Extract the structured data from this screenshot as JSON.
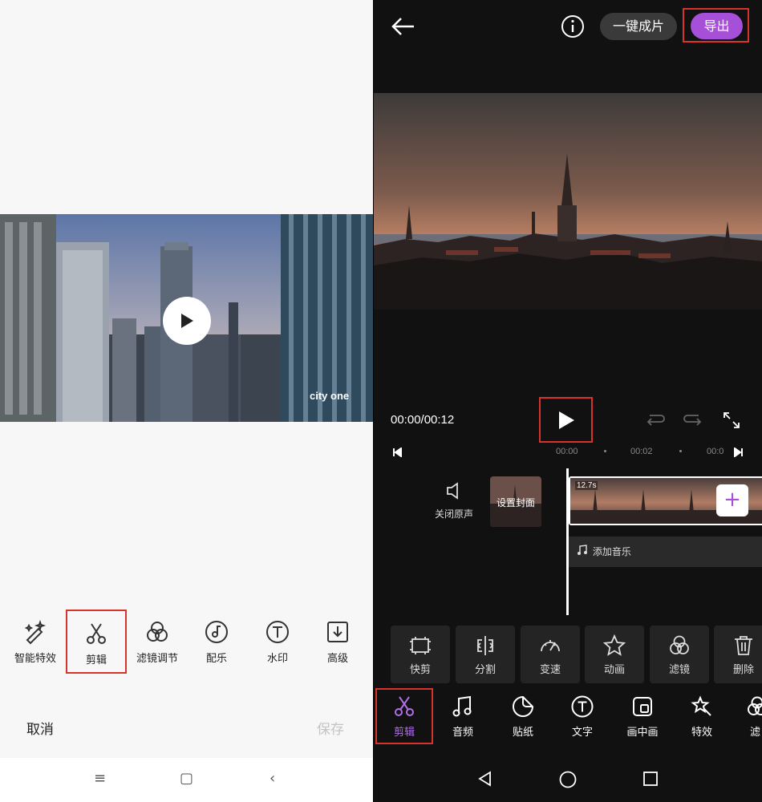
{
  "left": {
    "video_watermark": "city one",
    "tools": [
      {
        "label": "智能特效",
        "icon": "magic-wand-icon"
      },
      {
        "label": "剪辑",
        "icon": "scissors-icon"
      },
      {
        "label": "滤镜调节",
        "icon": "filter-circles-icon"
      },
      {
        "label": "配乐",
        "icon": "music-disc-icon"
      },
      {
        "label": "水印",
        "icon": "text-t-icon"
      },
      {
        "label": "高级",
        "icon": "download-box-icon"
      }
    ],
    "cancel_label": "取消",
    "save_label": "保存",
    "nav_menu_glyph": "≡",
    "nav_home_glyph": "▢",
    "nav_back_glyph": "‹"
  },
  "right": {
    "one_click_label": "一键成片",
    "export_label": "导出",
    "time_display": "00:00/00:12",
    "ruler": {
      "t0": "00:00",
      "t1": "00:02",
      "t2": "00:0"
    },
    "mute_label": "关闭原声",
    "cover_label": "设置封面",
    "clip_duration": "12.7s",
    "add_clip_glyph": "+",
    "music_label": "添加音乐",
    "edit_tools": [
      {
        "label": "快剪",
        "icon": "quick-cut-icon"
      },
      {
        "label": "分割",
        "icon": "split-icon"
      },
      {
        "label": "变速",
        "icon": "speedometer-icon"
      },
      {
        "label": "动画",
        "icon": "star-icon"
      },
      {
        "label": "滤镜",
        "icon": "filter-circles-icon"
      },
      {
        "label": "删除",
        "icon": "trash-icon"
      }
    ],
    "tabs": [
      {
        "label": "剪辑",
        "icon": "scissors-icon",
        "active": true
      },
      {
        "label": "音频",
        "icon": "music-note-icon"
      },
      {
        "label": "贴纸",
        "icon": "sticker-icon"
      },
      {
        "label": "文字",
        "icon": "text-t-icon"
      },
      {
        "label": "画中画",
        "icon": "picture-in-picture-icon"
      },
      {
        "label": "特效",
        "icon": "sparkle-wand-icon"
      },
      {
        "label": "滤",
        "icon": "filter-circles-icon"
      }
    ],
    "accent_color": "#a64fd8",
    "highlight_color": "#d8322d"
  }
}
